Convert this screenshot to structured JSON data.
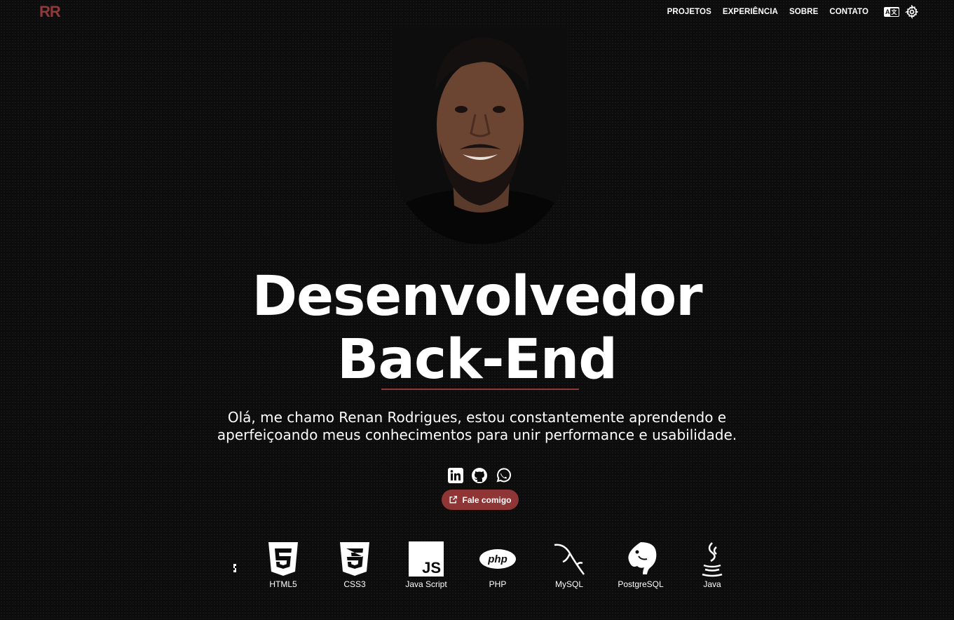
{
  "logo": "RR",
  "nav": {
    "items": [
      "PROJETOS",
      "EXPERIÊNCIA",
      "SOBRE",
      "CONTATO"
    ],
    "lang_icon": "translate-icon",
    "settings_icon": "gear-icon"
  },
  "hero": {
    "title_line1": "Desenvolvedor",
    "title_line2": "Back-End",
    "intro_line1": "Olá, me chamo Renan Rodrigues, estou constantemente aprendendo e",
    "intro_line2": "aperfeiçoando meus conhecimentos para unir performance e usabilidade.",
    "cta_label": "Fale comigo"
  },
  "socials": [
    "linkedin-icon",
    "github-icon",
    "whatsapp-icon"
  ],
  "techs": [
    "HTML5",
    "CSS3",
    "Java Script",
    "PHP",
    "MySQL",
    "PostgreSQL",
    "Java"
  ],
  "colors": {
    "accent": "#8f3535",
    "background": "#0c0c0c",
    "text": "#ffffff"
  }
}
